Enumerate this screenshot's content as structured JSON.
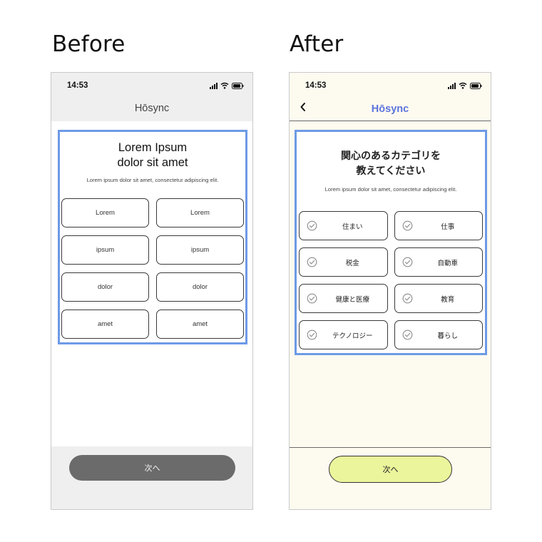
{
  "labels": {
    "before": "Before",
    "after": "After"
  },
  "before": {
    "status": {
      "time": "14:53"
    },
    "app_title": "Hōsync",
    "panel": {
      "title": "Lorem Ipsum\ndolor sit amet",
      "description": "Lorem ipsum dolor sit amet, consectetur adipiscing elit.",
      "options": [
        "Lorem",
        "Lorem",
        "ipsum",
        "ipsum",
        "dolor",
        "dolor",
        "amet",
        "amet"
      ]
    },
    "next_button": "次へ"
  },
  "after": {
    "status": {
      "time": "14:53"
    },
    "app_title": "Hōsync",
    "panel": {
      "title": "関心のあるカテゴリを\n教えてください",
      "description": "Lorem ipsum dolor sit amet, consectetur adipiscing elit.",
      "options": [
        "住まい",
        "仕事",
        "税金",
        "自動車",
        "健康と医療",
        "教育",
        "テクノロジー",
        "暮らし"
      ]
    },
    "next_button": "次へ"
  },
  "colors": {
    "highlight_border": "#6d9ae6",
    "after_title": "#5b74dd",
    "after_next_button": "#ebf59c",
    "before_next_button": "#6b6b6b"
  },
  "icons": {
    "back": "chevron-left-icon",
    "option_check": "check-circle-icon",
    "signal": "signal-icon",
    "wifi": "wifi-icon",
    "battery": "battery-icon"
  }
}
